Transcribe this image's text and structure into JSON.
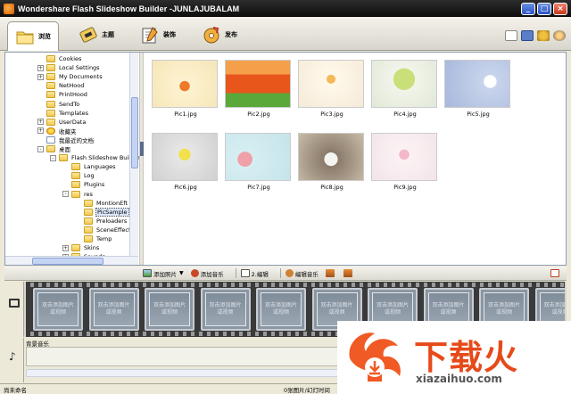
{
  "window": {
    "title": "Wondershare Flash Slideshow Builder -JUNLAJUBALAM",
    "buttons": {
      "minimize": "_",
      "maximize": "□",
      "close": "×"
    }
  },
  "tabs": [
    {
      "label": "浏览",
      "active": true
    },
    {
      "label": "主题",
      "active": false
    },
    {
      "label": "装饰",
      "active": false
    },
    {
      "label": "发布",
      "active": false
    }
  ],
  "tree": {
    "items": [
      {
        "label": "Cookies",
        "expander": ""
      },
      {
        "label": "Local Settings",
        "expander": "+"
      },
      {
        "label": "My Documents",
        "expander": "+"
      },
      {
        "label": "NetHood",
        "expander": ""
      },
      {
        "label": "PrintHood",
        "expander": ""
      },
      {
        "label": "SendTo",
        "expander": ""
      },
      {
        "label": "Templates",
        "expander": ""
      },
      {
        "label": "UserData",
        "expander": "+"
      },
      {
        "label": "收藏夹",
        "expander": "+"
      },
      {
        "label": "我最近的文档",
        "expander": ""
      },
      {
        "label": "桌面",
        "expander": "-"
      },
      {
        "label": "Flash Slideshow Builder",
        "expander": "-"
      },
      {
        "label": "Languages",
        "expander": ""
      },
      {
        "label": "Log",
        "expander": ""
      },
      {
        "label": "Plugins",
        "expander": ""
      },
      {
        "label": "res",
        "expander": "-"
      },
      {
        "label": "MontionEft",
        "expander": ""
      },
      {
        "label": "PicSample",
        "expander": "",
        "selected": true
      },
      {
        "label": "Preloaders",
        "expander": ""
      },
      {
        "label": "SceneEffects",
        "expander": ""
      },
      {
        "label": "Temp",
        "expander": ""
      },
      {
        "label": "Skins",
        "expander": "+"
      },
      {
        "label": "Sounds",
        "expander": "+"
      }
    ]
  },
  "thumbnails": [
    {
      "name": "Pic1.jpg"
    },
    {
      "name": "Pic2.jpg"
    },
    {
      "name": "Pic3.jpg"
    },
    {
      "name": "Pic4.jpg"
    },
    {
      "name": "Pic5.jpg"
    },
    {
      "name": "Pic6.jpg"
    },
    {
      "name": "Pic7.jpg"
    },
    {
      "name": "Pic8.jpg"
    },
    {
      "name": "Pic9.jpg"
    }
  ],
  "toolbar": {
    "add_photo": "添加照片",
    "add_music": "添加音乐",
    "edit": "2.编辑",
    "edit_music": "编辑音乐"
  },
  "filmstrip": {
    "placeholder": "双击添加图片或视频",
    "slot_count": 10
  },
  "music": {
    "label": "背景音乐"
  },
  "status": {
    "left": "尚未命名",
    "mid": "0张图片/幻灯时间"
  },
  "watermark": {
    "text": "下载火",
    "url": "xiazaihuo.com"
  }
}
